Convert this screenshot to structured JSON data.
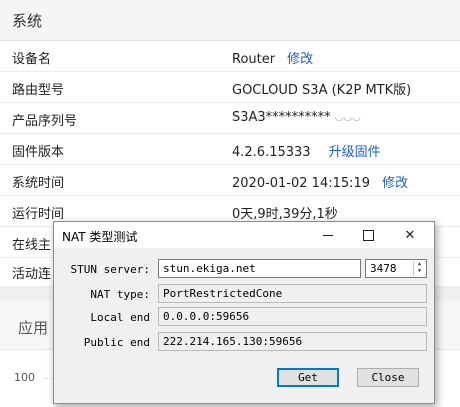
{
  "system": {
    "title": "系统",
    "rows": [
      {
        "label": "设备名",
        "value": "Router",
        "link": "修改"
      },
      {
        "label": "路由型号",
        "value": "GOCLOUD S3A (K2P MTK版)"
      },
      {
        "label": "产品序列号",
        "value": "S3A3**********"
      },
      {
        "label": "固件版本",
        "value": "4.2.6.15333",
        "link": "升级固件"
      },
      {
        "label": "系统时间",
        "value": "2020-01-02 14:15:19",
        "link": "修改"
      },
      {
        "label": "运行时间",
        "value": "0天,9时,39分,1秒"
      },
      {
        "label": "在线主",
        "value": ""
      },
      {
        "label": "活动连",
        "value": ""
      }
    ]
  },
  "app_section": {
    "title": "应用",
    "chart_tick": "100"
  },
  "dialog": {
    "title": "NAT 类型测试",
    "stun_label": "STUN server:",
    "stun_server": "stun.ekiga.net",
    "stun_port": "3478",
    "nat_type_label": "NAT type:",
    "nat_type": "PortRestrictedCone",
    "local_label": "Local end",
    "local_end": "0.0.0.0:59656",
    "public_label": "Public end",
    "public_end": "222.214.165.130:59656",
    "get_label": "Get",
    "close_label": "Close",
    "close_glyph": "✕"
  }
}
